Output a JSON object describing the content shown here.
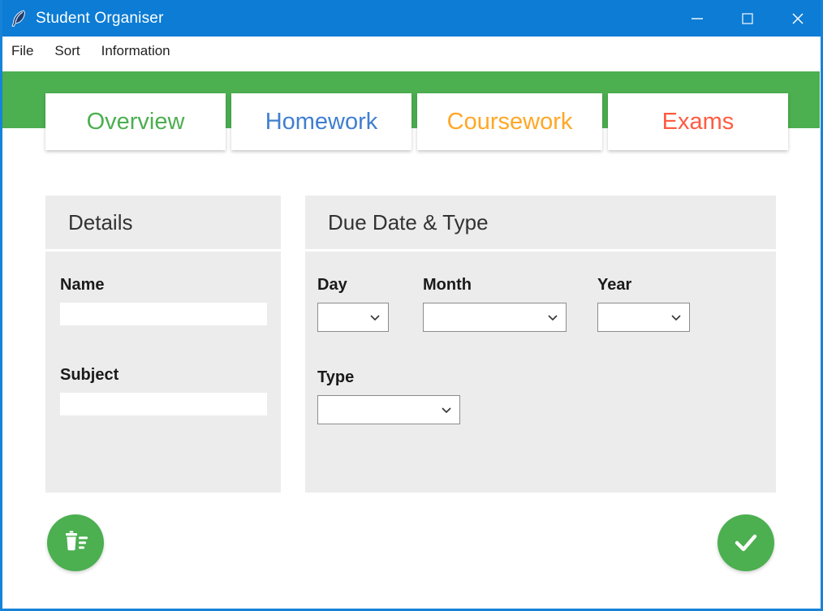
{
  "window": {
    "title": "Student Organiser",
    "icon": "feather-icon",
    "controls": {
      "minimize": "minimize-icon",
      "maximize": "maximize-icon",
      "close": "close-icon"
    }
  },
  "menubar": {
    "items": [
      {
        "label": "File"
      },
      {
        "label": "Sort"
      },
      {
        "label": "Information"
      }
    ]
  },
  "tabs": {
    "active": "Overview",
    "items": [
      {
        "label": "Overview",
        "color": "#4caf50"
      },
      {
        "label": "Homework",
        "color": "#3f7fd0"
      },
      {
        "label": "Coursework",
        "color": "#ffa726"
      },
      {
        "label": "Exams",
        "color": "#ff5b41"
      }
    ]
  },
  "details_panel": {
    "title": "Details",
    "name": {
      "label": "Name",
      "value": "",
      "placeholder": ""
    },
    "subject": {
      "label": "Subject",
      "value": "",
      "placeholder": ""
    }
  },
  "due_panel": {
    "title": "Due Date & Type",
    "day": {
      "label": "Day",
      "value": ""
    },
    "month": {
      "label": "Month",
      "value": ""
    },
    "year": {
      "label": "Year",
      "value": ""
    },
    "type": {
      "label": "Type",
      "value": ""
    }
  },
  "actions": {
    "delete": {
      "name": "delete-icon",
      "tooltip": ""
    },
    "confirm": {
      "name": "check-icon",
      "tooltip": ""
    }
  },
  "colors": {
    "titlebar": "#0c7cd5",
    "banner": "#4caf50",
    "panel": "#ececec",
    "accent": "#4caf50"
  }
}
